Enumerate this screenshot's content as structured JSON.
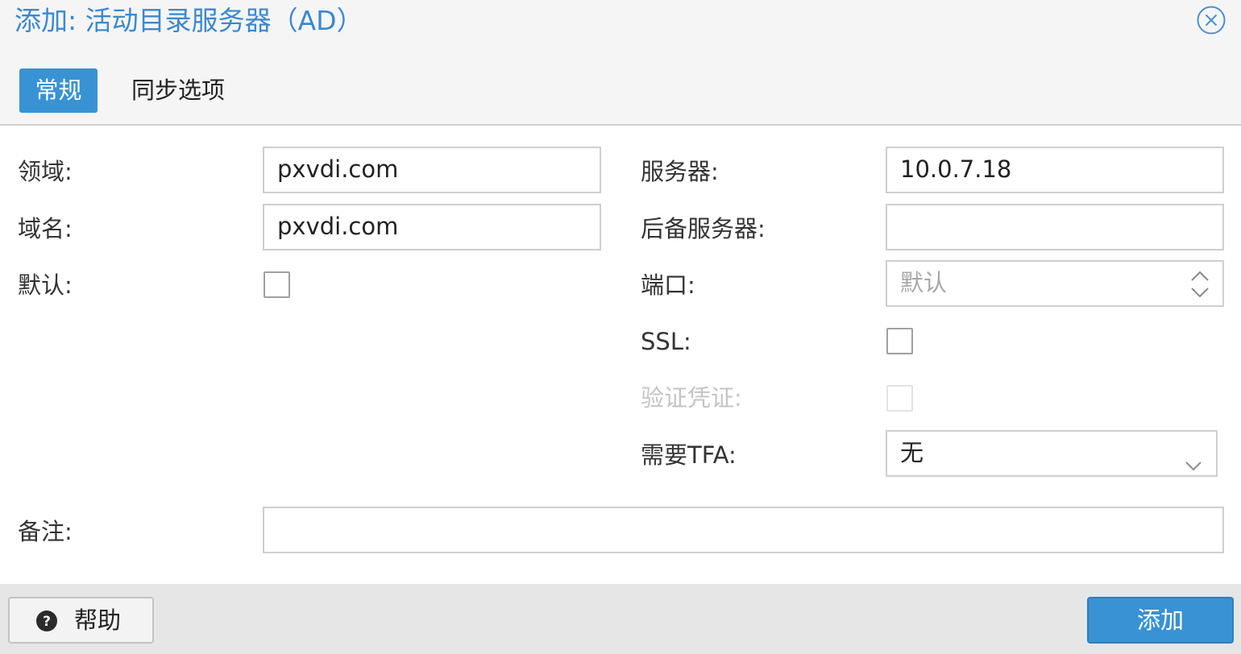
{
  "dialog": {
    "title": "添加: 活动目录服务器（AD）",
    "close_icon": "close-circle-icon",
    "accent_color": "#3892d4"
  },
  "tabs": [
    {
      "label": "常规",
      "active": true
    },
    {
      "label": "同步选项",
      "active": false
    }
  ],
  "form": {
    "realm": {
      "label": "领域:",
      "value": "pxvdi.com"
    },
    "domain": {
      "label": "域名:",
      "value": "pxvdi.com"
    },
    "default": {
      "label": "默认:",
      "checked": false
    },
    "server": {
      "label": "服务器:",
      "value": "10.0.7.18"
    },
    "fallback_server": {
      "label": "后备服务器:",
      "value": ""
    },
    "port": {
      "label": "端口:",
      "placeholder": "默认",
      "icon": "spinner-updown-icon"
    },
    "ssl": {
      "label": "SSL:",
      "checked": false
    },
    "verify_cert": {
      "label": "验证凭证:",
      "checked": false,
      "disabled": true
    },
    "require_tfa": {
      "label": "需要TFA:",
      "value": "无",
      "icon": "chevron-down-icon"
    },
    "comment": {
      "label": "备注:",
      "value": ""
    }
  },
  "footer": {
    "help_label": "帮助",
    "help_icon": "question-circle-icon",
    "add_label": "添加"
  }
}
